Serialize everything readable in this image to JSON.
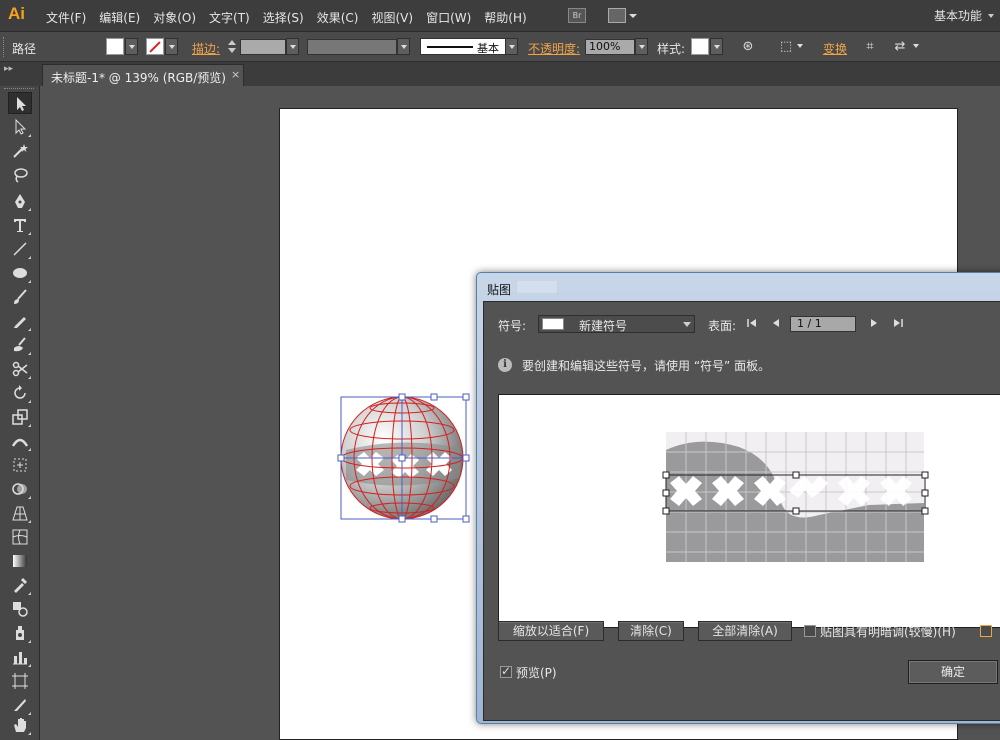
{
  "app": {
    "logo": "Ai",
    "menu": [
      "文件(F)",
      "编辑(E)",
      "对象(O)",
      "文字(T)",
      "选择(S)",
      "效果(C)",
      "视图(V)",
      "窗口(W)",
      "帮助(H)"
    ],
    "bridge_label": "Br",
    "workspace": "基本功能"
  },
  "control_bar": {
    "object_type": "路径",
    "stroke_label": "描边:",
    "stroke_style": "基本",
    "opacity_label": "不透明度:",
    "opacity_value": "100%",
    "style_label": "样式:",
    "transform_label": "变换"
  },
  "document": {
    "tab_title": "未标题-1* @ 139% (RGB/预览)",
    "close": "×"
  },
  "toolbar": {
    "tools": [
      "selection",
      "direct-selection",
      "magic-wand",
      "lasso",
      "pen",
      "type",
      "line",
      "ellipse",
      "paintbrush",
      "pencil",
      "blob-brush",
      "scissors",
      "rotate",
      "scale",
      "width",
      "free-transform",
      "shape-builder",
      "perspective-grid",
      "mesh",
      "gradient",
      "eyedropper",
      "blend",
      "symbol-sprayer",
      "column-graph",
      "artboard",
      "slice",
      "hand"
    ],
    "active": "selection"
  },
  "dialog": {
    "title": "贴图",
    "symbol_label": "符号:",
    "symbol_value": "新建符号",
    "surface_label": "表面:",
    "surface_value": "1 / 1",
    "info": "要创建和编辑这些符号，请使用 “符号” 面板。",
    "btn_scale": "缩放以适合(F)",
    "btn_clear": "清除(C)",
    "btn_clear_all": "全部清除(A)",
    "shade_label": "贴图具有明暗调(较慢)(H)",
    "shade_checked": false,
    "preview_label": "预览(P)",
    "preview_checked": true,
    "ok": "确定"
  },
  "colors": {
    "accent_orange": "#f0a44a",
    "selection_blue": "#4a5fc0",
    "mesh_red": "#d41f1f"
  }
}
